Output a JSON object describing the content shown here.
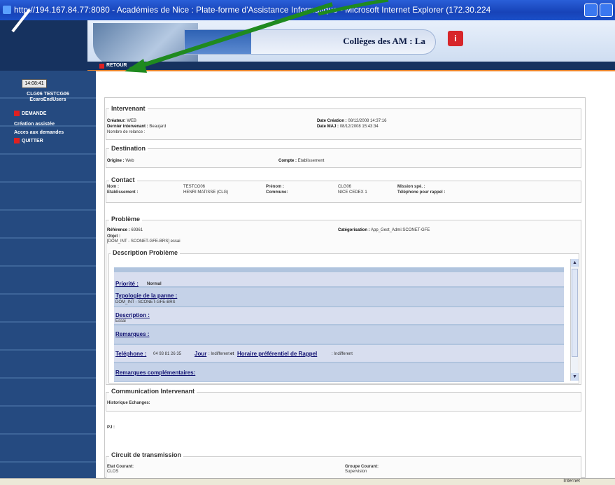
{
  "window": {
    "title": "http://194.167.84.77:8080 - Académies de Nice : Plate-forme d'Assistance Informatique - Microsoft Internet Explorer (172.30.224"
  },
  "header": {
    "site_label": "Collèges des AM : La",
    "retour": "RETOUR"
  },
  "sidebar": {
    "clock": "14:08:41",
    "user_line1": "CLG06 TESTCG06",
    "user_line2": "EcaroEndUsers",
    "items": [
      {
        "label": "DEMANDE"
      },
      {
        "label": "Création assistée"
      },
      {
        "label": "Acces aux demandes"
      },
      {
        "label": "QUITTER"
      }
    ]
  },
  "intervenant": {
    "legend": "Intervenant",
    "createur_label": "Créateur:",
    "createur": "WEB",
    "dernier_label": "Dernier intervenant :",
    "dernier": "Beaujard",
    "relance_label": "Nombre de relance :",
    "date_creation_label": "Date Création :",
    "date_creation": "08/12/2008 14:37:16",
    "date_maj_label": "Date MAJ :",
    "date_maj": "08/12/2008 15:43:34"
  },
  "destination": {
    "legend": "Destination",
    "origine_label": "Origine :",
    "origine": "Web",
    "compte_label": "Compte :",
    "compte": "Etablissement"
  },
  "contact": {
    "legend": "Contact",
    "nom_label": "Nom :",
    "nom": "TESTCG06",
    "etab_label": "Etablissement :",
    "etab": "HENRI MATISSE (CLG)",
    "prenom_label": "Prénom :",
    "prenom": "CLG06",
    "commune_label": "Commune:",
    "commune": "NICE CEDEX 1",
    "mission_label": "Mission spé. :",
    "tel_label": "Téléphone pour rappel :"
  },
  "probleme": {
    "legend": "Problème",
    "ref_label": "Référence :",
    "ref": "69361",
    "cat_label": "Catégorisation :",
    "cat": "App_Gest_Admi:SCONET-GFE",
    "objet_label": "Objet :",
    "objet": "[DOM_INT - SCONET-GFE-BRS] essai",
    "desc_legend": "Description Problème"
  },
  "description": {
    "priorite_label": "Priorité :",
    "priorite": "Normal",
    "typologie_label": "Typologie de la panne :",
    "typologie": "DOM_INT - SCONET-GFE-BRS",
    "desc_label": "Description :",
    "desc": "Essai",
    "remarques_label": "Remarques :",
    "tel_label": "Teléphone :",
    "tel": "04 93 81 26 35",
    "jour_label": "Jour",
    "jour": ": Indifferent",
    "et": "et",
    "horaire_label": "Horaire préférentiel de Rappel",
    "horaire": ": Indifferent",
    "rem_comp_label": "Remarques complémentaires:"
  },
  "communication": {
    "legend": "Communication Intervenant",
    "historique": "Historique Echanges:",
    "pj": "PJ :"
  },
  "circuit": {
    "legend": "Circuit de transmission",
    "etat_label": "Etat Courant:",
    "etat": "CLOS",
    "groupe_label": "Groupe Courant:",
    "groupe": "Supervision"
  },
  "status": {
    "zone": "Internet"
  },
  "colors": {
    "sidebar": "#254a80",
    "accent": "#e8842e",
    "arrow": "#1f8a1f"
  }
}
